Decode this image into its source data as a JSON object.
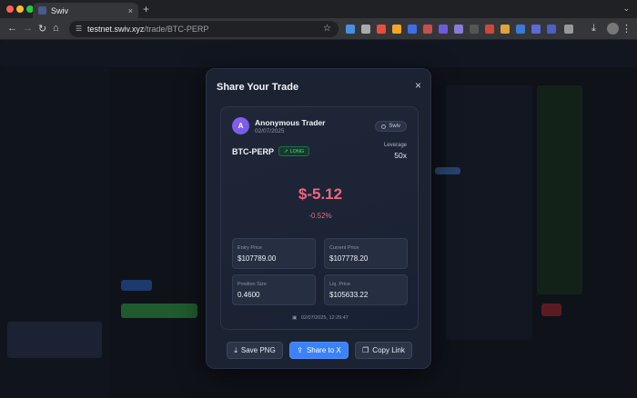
{
  "browser": {
    "tab_title": "Swiv",
    "tab_close": "×",
    "new_tab": "+",
    "url_host": "testnet.swiv.xyz",
    "url_path": "/trade/BTC-PERP",
    "icons": [
      "back-arrow-icon",
      "forward-arrow-icon",
      "reload-icon",
      "home-icon",
      "site-settings-icon",
      "bookmark-star-icon",
      "download-icon",
      "extensions-icon",
      "profile-avatar",
      "kebab-menu-icon"
    ]
  },
  "modal": {
    "title": "Share Your Trade",
    "close_icon": "×",
    "card": {
      "avatar_letter": "A",
      "trader_name": "Anonymous Trader",
      "date": "02/07/2025",
      "brand": "Swiv",
      "pair": "BTC-PERP",
      "side": "LONG",
      "side_icon": "↗",
      "leverage_label": "Leverage",
      "leverage_value": "50x",
      "pnl": "$-5.12",
      "pnl_pct": "-0.52%",
      "entry_label": "Entry Price",
      "entry_value": "$107789.00",
      "current_label": "Current Price",
      "current_value": "$107778.20",
      "size_label": "Position Size",
      "size_value": "0.4600",
      "liq_label": "Liq. Price",
      "liq_value": "$105633.22",
      "timestamp": "02/07/2025, 12:29:47"
    },
    "buttons": {
      "save_png": "Save PNG",
      "share_x": "Share to X",
      "copy_link": "Copy Link"
    }
  },
  "colors": {
    "accent_blue": "#3b82f6",
    "loss_red": "#f0667d",
    "long_green": "#4ade80"
  }
}
